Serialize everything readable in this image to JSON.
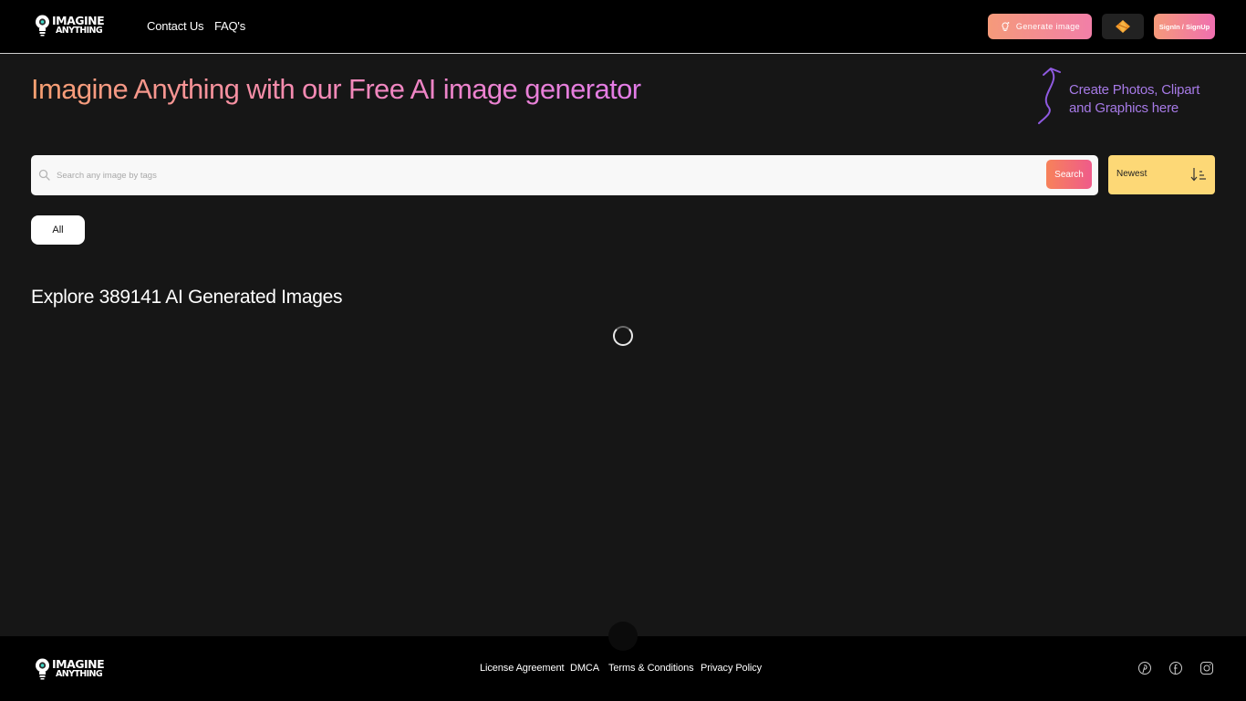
{
  "header": {
    "logo": {
      "line1": "IMAGINE",
      "line2": "ANYTHING"
    },
    "nav": [
      {
        "label": "Contact Us"
      },
      {
        "label": "FAQ's"
      }
    ],
    "generate_label": "Generate image",
    "signin_label": "SignIn / SignUp"
  },
  "hero": {
    "title": "Imagine Anything with our Free AI image generator",
    "side_text": "Create Photos, Clipart and Graphics here"
  },
  "search": {
    "placeholder": "Search any image by tags",
    "value": "",
    "button_label": "Search",
    "sort_label": "Newest"
  },
  "filters": [
    {
      "label": "All"
    }
  ],
  "explore": {
    "title": "Explore 389141 AI Generated Images"
  },
  "footer": {
    "logo": {
      "line1": "IMAGINE",
      "line2": "ANYTHING"
    },
    "links": [
      {
        "label": "License Agreement"
      },
      {
        "label": "DMCA"
      },
      {
        "label": "Terms & Conditions"
      },
      {
        "label": "Privacy Policy"
      }
    ],
    "social": [
      "pinterest-icon",
      "facebook-icon",
      "instagram-icon"
    ]
  },
  "colors": {
    "background": "#161616",
    "header_bg": "#000000",
    "accent_orange": "#f59a7a",
    "accent_pink": "#f27fa8",
    "accent_purple": "#a67ae6",
    "sort_yellow": "#fdd876"
  }
}
